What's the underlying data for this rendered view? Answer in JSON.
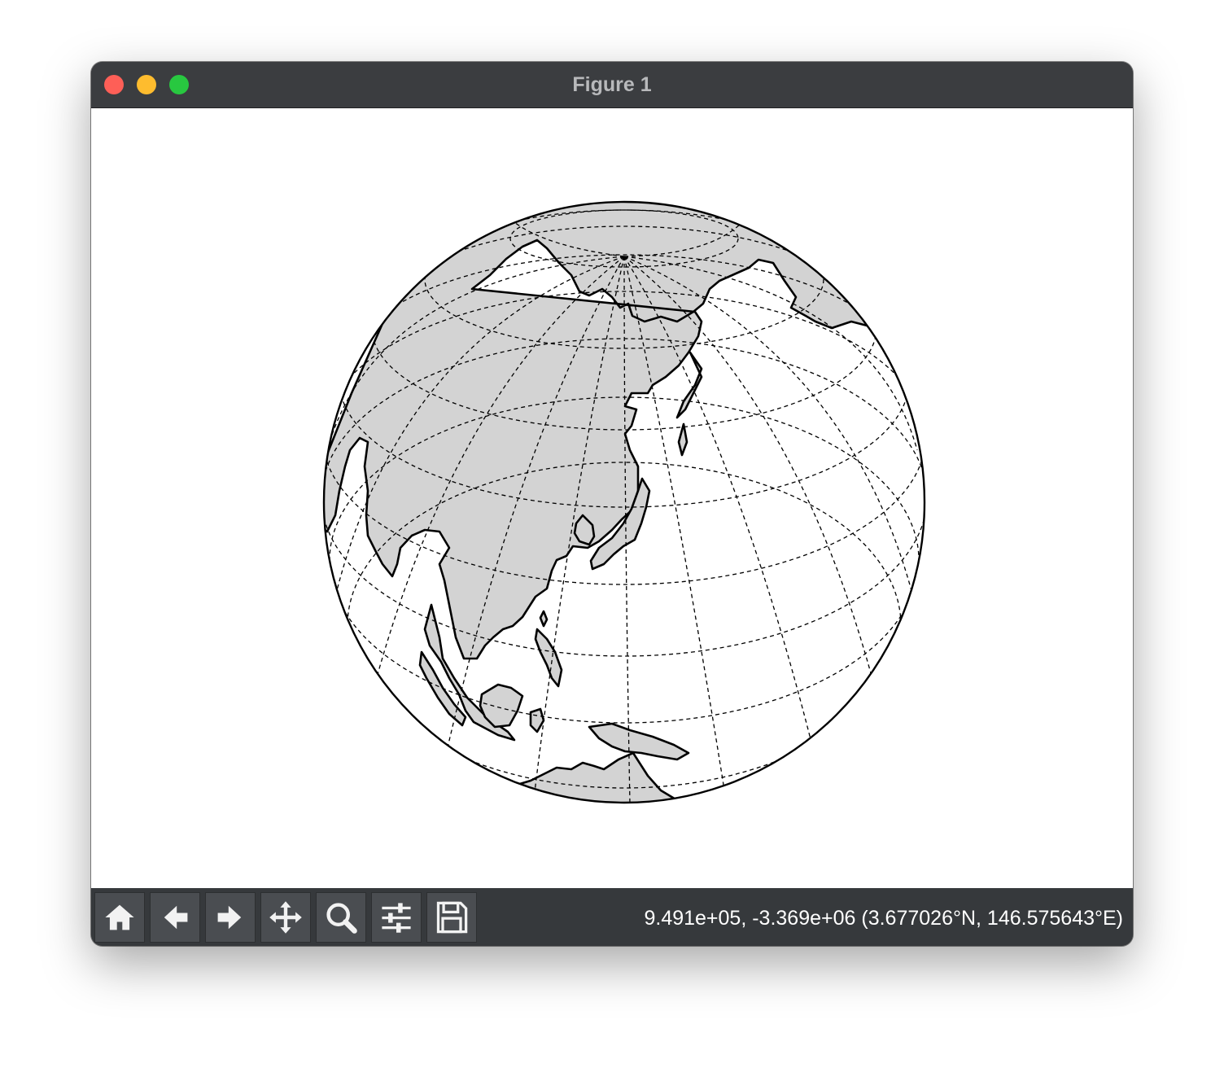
{
  "window": {
    "title": "Figure 1"
  },
  "toolbar": {
    "buttons": [
      {
        "id": "home",
        "icon": "home-icon"
      },
      {
        "id": "back",
        "icon": "arrow-left-icon"
      },
      {
        "id": "forward",
        "icon": "arrow-right-icon"
      },
      {
        "id": "pan",
        "icon": "move-arrows-icon"
      },
      {
        "id": "zoom",
        "icon": "magnifier-icon"
      },
      {
        "id": "configure",
        "icon": "sliders-icon"
      },
      {
        "id": "save",
        "icon": "floppy-disk-icon"
      }
    ],
    "coordinates": "9.491e+05, -3.369e+06 (3.677026°N, 146.575643°E)"
  },
  "map": {
    "projection": "orthographic",
    "land_color": "#d3d3d3",
    "ocean_color": "#ffffff",
    "coastline_color": "#000000",
    "graticule_style": "dashed"
  },
  "colors": {
    "titlebar": "#3b3d40",
    "toolbar": "#36393c",
    "close": "#fe5f57",
    "minimize": "#febc2e",
    "maximize": "#28c840"
  }
}
